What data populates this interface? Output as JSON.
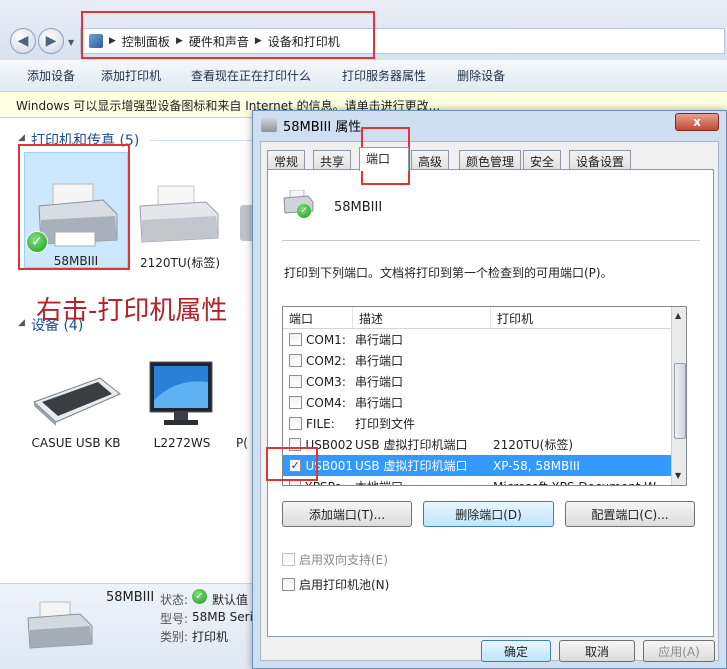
{
  "breadcrumb": [
    "控制面板",
    "硬件和声音",
    "设备和打印机"
  ],
  "toolbar": [
    "添加设备",
    "添加打印机",
    "查看现在正在打印什么",
    "打印服务器属性",
    "删除设备"
  ],
  "infobar": "Windows 可以显示增强型设备图标和来自 Internet 的信息。请单击进行更改...",
  "printers_section": {
    "title": "打印机和传真 (5)",
    "items": [
      "58MBIII",
      "2120TU(标签)"
    ]
  },
  "devices_section": {
    "title": "设备 (4)",
    "items": [
      "CASUE USB KB",
      "L2272WS",
      "P("
    ]
  },
  "annotation": "右击-打印机属性",
  "details": {
    "name": "58MBIII",
    "status_label": "状态:",
    "status_value": "默认值",
    "model_label": "型号:",
    "model_value": "58MB Seri",
    "category_label": "类别:",
    "category_value": "打印机"
  },
  "dialog": {
    "title": "58MBIII 属性",
    "close": "x",
    "tabs": [
      "常规",
      "共享",
      "端口",
      "高级",
      "颜色管理",
      "安全",
      "设备设置"
    ],
    "active_tab": "端口",
    "printer_name": "58MBIII",
    "instruction": "打印到下列端口。文档将打印到第一个检查到的可用端口(P)。",
    "columns": [
      "端口",
      "描述",
      "打印机"
    ],
    "ports": [
      {
        "port": "COM1:",
        "desc": "串行端口",
        "printer": "",
        "checked": false,
        "selected": false
      },
      {
        "port": "COM2:",
        "desc": "串行端口",
        "printer": "",
        "checked": false,
        "selected": false
      },
      {
        "port": "COM3:",
        "desc": "串行端口",
        "printer": "",
        "checked": false,
        "selected": false
      },
      {
        "port": "COM4:",
        "desc": "串行端口",
        "printer": "",
        "checked": false,
        "selected": false
      },
      {
        "port": "FILE:",
        "desc": "打印到文件",
        "printer": "",
        "checked": false,
        "selected": false
      },
      {
        "port": "USB002",
        "desc": "USB 虚拟打印机端口",
        "printer": "2120TU(标签)",
        "checked": false,
        "selected": false
      },
      {
        "port": "USB001",
        "desc": "USB 虚拟打印机端口",
        "printer": "XP-58, 58MBIII",
        "checked": true,
        "selected": true
      },
      {
        "port": "XPSPo...",
        "desc": "本地端口",
        "printer": "Microsoft XPS Document W...",
        "checked": false,
        "selected": false
      }
    ],
    "buttons": {
      "add": "添加端口(T)...",
      "delete": "删除端口(D)",
      "config": "配置端口(C)..."
    },
    "bidi": "启用双向支持(E)",
    "pool": "启用打印机池(N)",
    "ok": "确定",
    "cancel": "取消",
    "apply": "应用(A)"
  }
}
